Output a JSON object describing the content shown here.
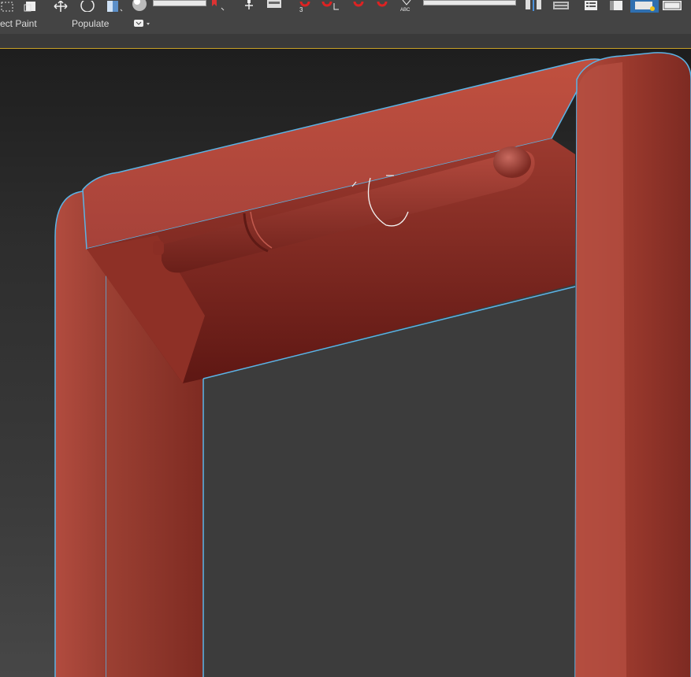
{
  "ribbon": {
    "tabs": [
      {
        "label": "ect Paint"
      },
      {
        "label": "Populate"
      }
    ]
  },
  "viewport": {
    "selection_outline_color": "#5bb4e6",
    "object_color": "#b44a3d"
  },
  "icons": [
    "select-region-icon",
    "window-select-icon",
    "move-icon",
    "rotate-icon",
    "scale-icon",
    "sphere-render-icon",
    "selection-set-field",
    "named-set-icon",
    "pivot-icon",
    "snap-toggle-icon",
    "angle-snap-icon",
    "percent-snap-icon",
    "spinner-snap-icon",
    "spelling-abc-icon",
    "named-selection-field",
    "mirror-icon",
    "align-icon",
    "layer-manager-icon",
    "scene-explorer-icon",
    "ribbon-toggle-icon",
    "material-editor-icon"
  ]
}
